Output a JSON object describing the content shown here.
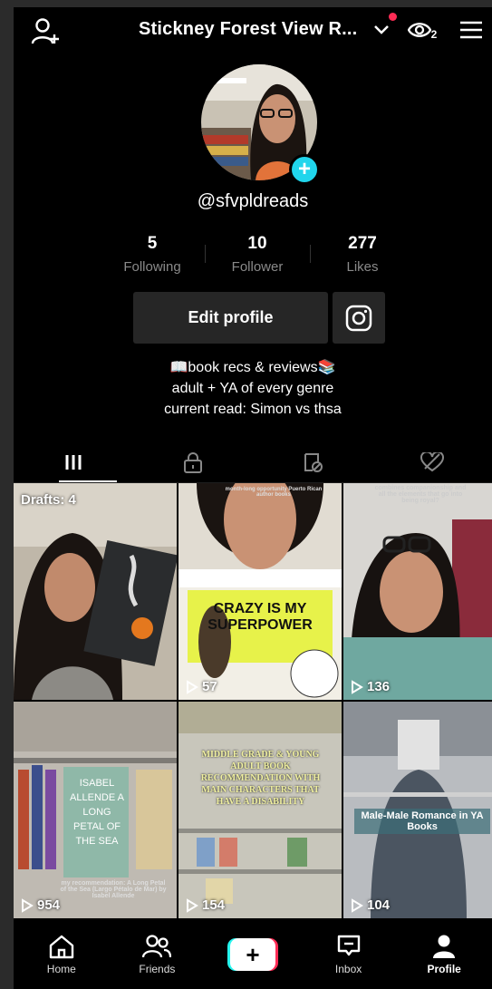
{
  "header": {
    "title": "Stickney Forest View R...",
    "eye_count": "2"
  },
  "profile": {
    "username": "@sfvpldreads",
    "add_icon": "+"
  },
  "stats": [
    {
      "value": "5",
      "label": "Following"
    },
    {
      "value": "10",
      "label": "Follower"
    },
    {
      "value": "277",
      "label": "Likes"
    }
  ],
  "actions": {
    "edit_profile": "Edit profile"
  },
  "bio": {
    "line1": "📖book recs & reviews📚",
    "line2": "adult + YA of every genre",
    "line3": "current read: Simon vs thsa"
  },
  "tabs": [
    "videos-grid-icon",
    "private-lock-icon",
    "reposts-icon",
    "liked-heart-icon"
  ],
  "videos": [
    {
      "drafts": "Drafts: 4"
    },
    {
      "views": "57",
      "cover_text": "CRAZY IS MY SUPERPOWER",
      "caption": "month-long opportunity Puerto Rican author books"
    },
    {
      "views": "136",
      "caption": "combines companionship and all the elements that go into being royal?"
    },
    {
      "views": "954",
      "cover_text": "ISABEL ALLENDE A LONG PETAL OF THE SEA",
      "caption": "my recommendation: A Long Petal of the Sea (Largo Pétalo de Mar) by Isabel Allende"
    },
    {
      "views": "154",
      "caption": "MIDDLE GRADE & YOUNG ADULT BOOK RECOMMENDATION WITH MAIN CHARACTERS THAT HAVE A DISABILITY"
    },
    {
      "views": "104",
      "caption": "Male-Male Romance in YA Books"
    }
  ],
  "nav": [
    {
      "label": "Home",
      "icon": "home-icon"
    },
    {
      "label": "Friends",
      "icon": "friends-icon"
    },
    {
      "label": "",
      "icon": "create-plus-icon",
      "plus": "+"
    },
    {
      "label": "Inbox",
      "icon": "inbox-icon"
    },
    {
      "label": "Profile",
      "icon": "profile-icon"
    }
  ],
  "colors": {
    "accent_red": "#fe2c55",
    "accent_cyan": "#25f4ee",
    "avatar_plus": "#20d5ec"
  }
}
